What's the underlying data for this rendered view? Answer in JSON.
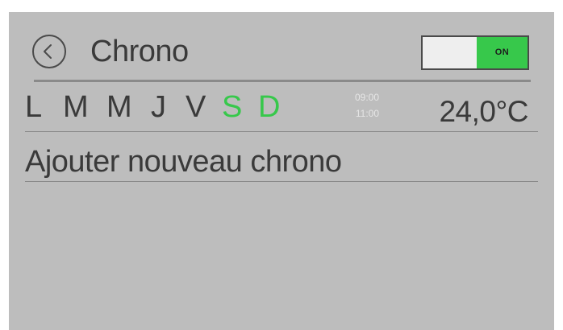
{
  "header": {
    "title": "Chrono",
    "back_icon": "chevron-left-circle-icon",
    "toggle": {
      "state_label": "ON",
      "on": true,
      "accent_color": "#37c84b"
    }
  },
  "chrono": {
    "days": [
      {
        "label": "L",
        "active": false
      },
      {
        "label": "M",
        "active": false
      },
      {
        "label": "M",
        "active": false
      },
      {
        "label": "J",
        "active": false
      },
      {
        "label": "V",
        "active": false
      },
      {
        "label": "S",
        "active": true
      },
      {
        "label": "D",
        "active": true
      }
    ],
    "start_time": "09:00",
    "end_time": "11:00",
    "temperature": "24,0°C"
  },
  "add_chrono_label": "Ajouter nouveau chrono",
  "colors": {
    "background": "#bdbdbd",
    "text": "#3a3a3a",
    "active_day": "#37c84b",
    "time_text": "#e6e6e6"
  }
}
